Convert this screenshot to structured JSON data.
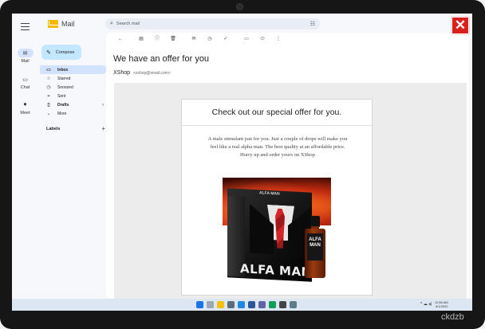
{
  "app": {
    "name": "Mail"
  },
  "rail": {
    "items": [
      {
        "label": "Mail",
        "icon": "mail-icon"
      },
      {
        "label": "Chat",
        "icon": "chat-icon"
      },
      {
        "label": "Meet",
        "icon": "video-icon"
      }
    ]
  },
  "search": {
    "placeholder": "Search mail"
  },
  "compose": {
    "label": "Compose"
  },
  "nav": {
    "items": [
      {
        "label": "Inbox",
        "icon": "inbox-icon"
      },
      {
        "label": "Starred",
        "icon": "star-icon"
      },
      {
        "label": "Snoozed",
        "icon": "clock-icon"
      },
      {
        "label": "Sent",
        "icon": "send-icon"
      },
      {
        "label": "Drafts",
        "icon": "draft-icon"
      },
      {
        "label": "More",
        "icon": "chevron-down-icon"
      }
    ],
    "labels_header": "Labels"
  },
  "message": {
    "subject": "We have an offer for you",
    "sender_name": "XShop",
    "sender_email": "<xshop@xmail.com>",
    "card_title": "Check out our special offer for you.",
    "body_text": "A male stimulant just for you. Just a couple of drops will make you feel like a real alpha man. The best quality at an affordable price. Hurry up and order yours on XShop",
    "product": {
      "box_title": "ALFA MAN",
      "box_top_text": "ALFA MAN",
      "bottle_label_line1": "ALFA",
      "bottle_label_line2": "MAN"
    }
  },
  "close_button": {
    "label": "✕"
  },
  "taskbar": {
    "time": "11:56 AM",
    "date": "9/1/2022"
  },
  "watermark": "ckdzb",
  "colors": {
    "close_red": "#d9201c",
    "compose_blue": "#c2e7ff",
    "active_nav": "#d3e3fd"
  }
}
